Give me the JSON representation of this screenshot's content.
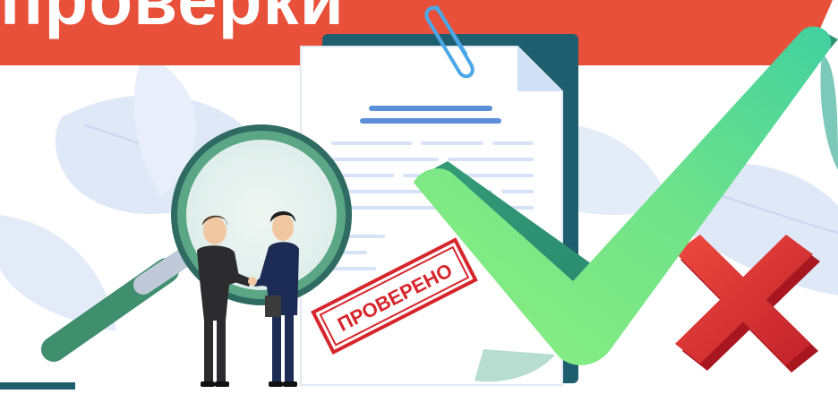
{
  "banner": {
    "title": "проверки",
    "color": "#e8503a"
  },
  "stamp": {
    "text": "ПРОВЕРЕНО",
    "color": "#d7262b"
  },
  "colors": {
    "check_light": "#7ee87f",
    "check_dark": "#2e9d78",
    "cross": "#d7262b",
    "magnifier": "#3f8f6e",
    "folder": "#1f5e6e",
    "leaf": "#dde7f6"
  },
  "icons": [
    "magnifier-icon",
    "document-icon",
    "paperclip-icon",
    "checkmark-icon",
    "cross-icon",
    "stamp-icon"
  ]
}
